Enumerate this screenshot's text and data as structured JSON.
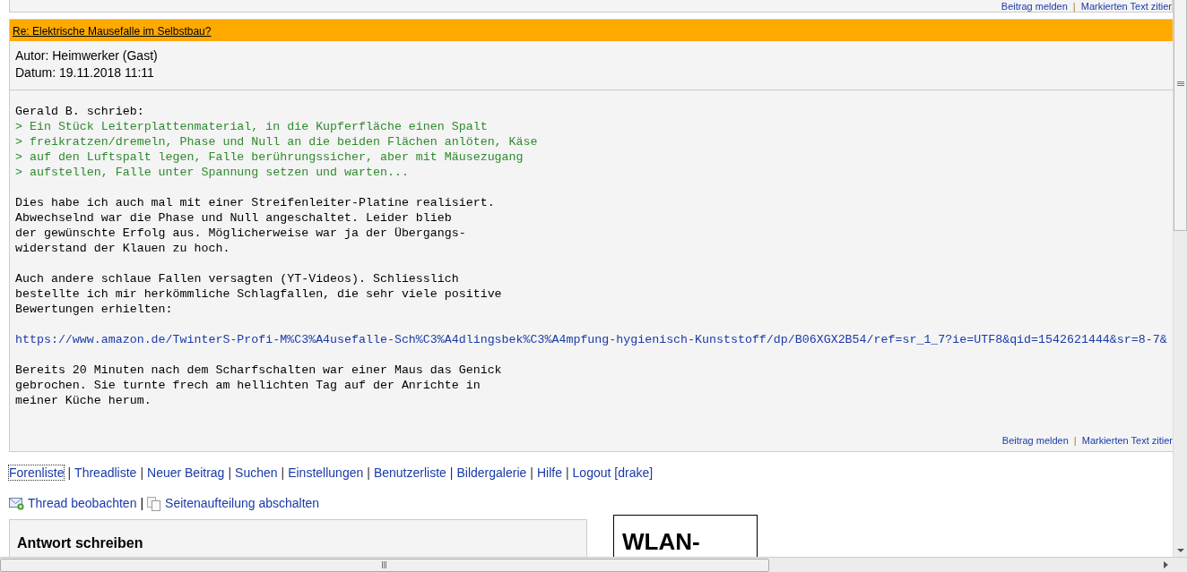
{
  "top_post_actions": {
    "separator": "|",
    "items": [
      "Beitrag melden",
      "Markierten Text zitier"
    ]
  },
  "post": {
    "title": "Re: Elektrische Mausefalle im Selbstbau?",
    "meta": [
      "Autor: Heimwerker (Gast)",
      "Datum: 19.11.2018 11:11"
    ],
    "body": [
      {
        "kind": "attribution",
        "lines": [
          "Gerald B. schrieb:"
        ]
      },
      {
        "kind": "quote",
        "lines": [
          "> Ein Stück Leiterplattenmaterial, in die Kupferfläche einen Spalt",
          "> freikratzen/dremeln, Phase und Null an die beiden Flächen anlöten, Käse",
          "> auf den Luftspalt legen, Falle berührungssicher, aber mit Mäusezugang",
          "> aufstellen, Falle unter Spannung setzen und warten..."
        ]
      },
      {
        "kind": "text",
        "lines": [
          "Dies habe ich auch mal mit einer Streifenleiter-Platine realisiert.",
          "Abwechselnd war die Phase und Null angeschaltet. Leider blieb",
          "der gewünschte Erfolg aus. Möglicherweise war ja der Übergangs-",
          "widerstand der Klauen zu hoch."
        ]
      },
      {
        "kind": "text",
        "lines": [
          "Auch andere schlaue Fallen versagten (YT-Videos). Schliesslich",
          "bestellte ich mir herkömmliche Schlagfallen, die sehr viele positive",
          "Bewertungen erhielten:"
        ]
      },
      {
        "kind": "link",
        "lines": [
          "https://www.amazon.de/TwinterS-Profi-M%C3%A4usefalle-Sch%C3%A4dlingsbek%C3%A4mpfung-hygienisch-Kunststoff/dp/B06XGX2B54/ref=sr_1_7?ie=UTF8&qid=1542621444&sr=8-7&"
        ]
      },
      {
        "kind": "text",
        "lines": [
          "Bereits 20 Minuten nach dem Scharfschalten war einer Maus das Genick",
          "gebrochen. Sie turnte frech am hellichten Tag auf der Anrichte in",
          "meiner Küche herum."
        ]
      }
    ],
    "actions": {
      "separator": "|",
      "items": [
        "Beitrag melden",
        "Markierten Text zitier"
      ]
    }
  },
  "nav": {
    "separator": "|",
    "items": [
      {
        "label": "Forenliste",
        "focused": true
      },
      {
        "label": "Threadliste",
        "focused": false
      },
      {
        "label": "Neuer Beitrag",
        "focused": false
      },
      {
        "label": "Suchen",
        "focused": false
      },
      {
        "label": "Einstellungen",
        "focused": false
      },
      {
        "label": "Benutzerliste",
        "focused": false
      },
      {
        "label": "Bildergalerie",
        "focused": false
      },
      {
        "label": "Hilfe",
        "focused": false
      },
      {
        "label": "Logout [drake]",
        "focused": false
      }
    ]
  },
  "thread_actions": {
    "separator": "|",
    "items": [
      {
        "kind": "watch",
        "label": "Thread beobachten"
      },
      {
        "kind": "paging",
        "label": "Seitenaufteilung abschalten"
      }
    ]
  },
  "reply_box": {
    "title": "Antwort schreiben"
  },
  "ad": {
    "title": "WLAN-"
  }
}
